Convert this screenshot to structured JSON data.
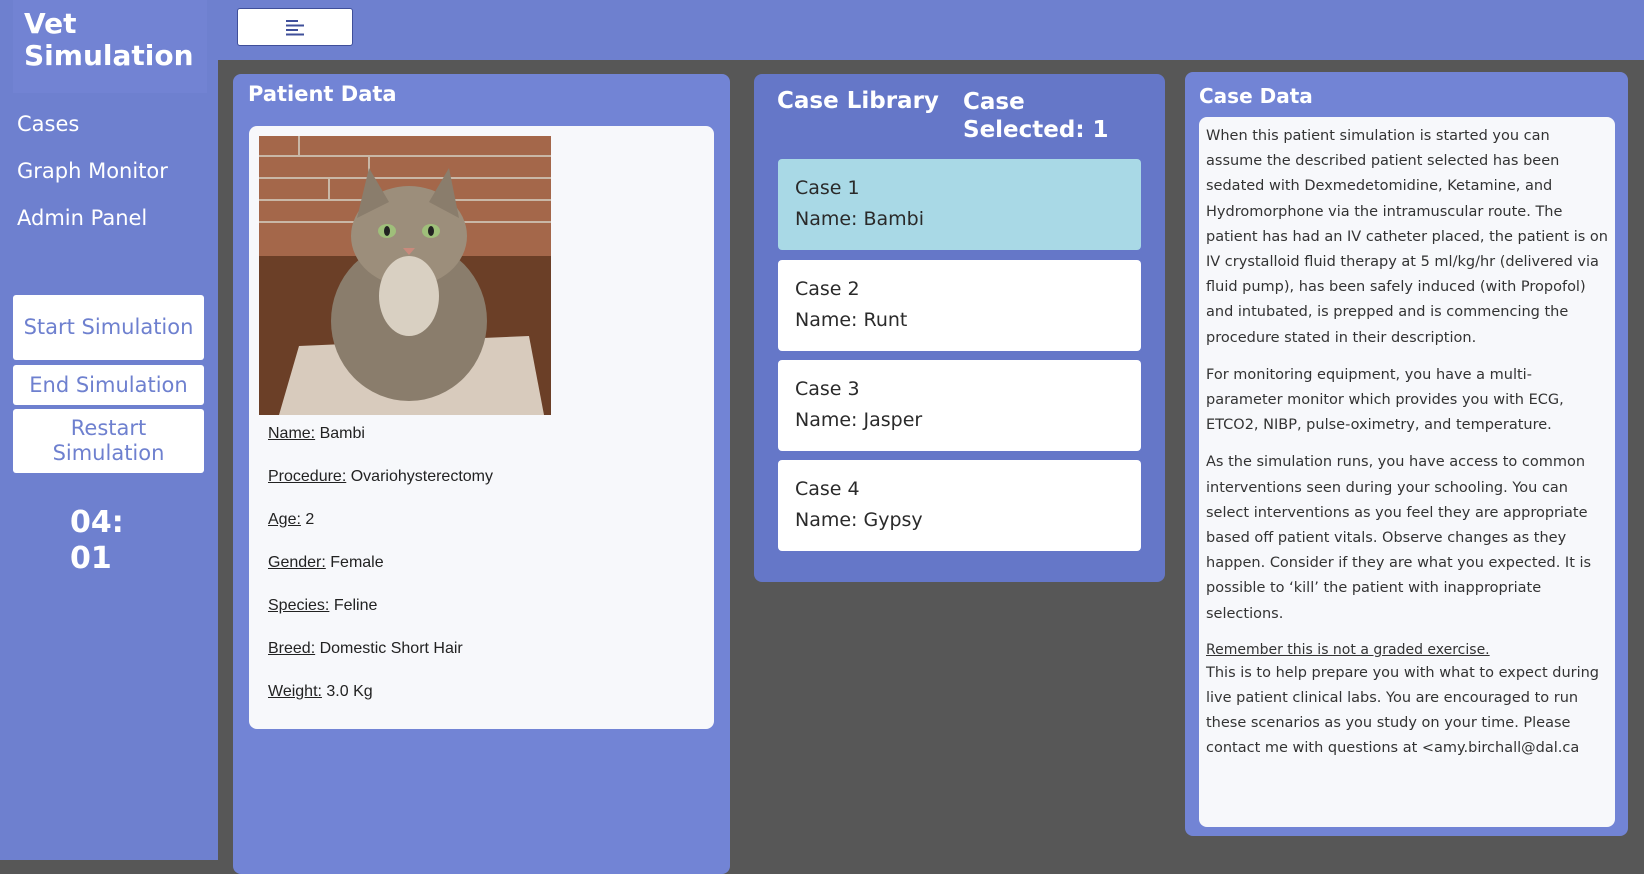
{
  "app": {
    "title": "Vet Simulation"
  },
  "sidebar": {
    "nav": [
      "Cases",
      "Graph Monitor",
      "Admin Panel"
    ],
    "buttons": {
      "start": "Start Simulation",
      "end": "End Simulation",
      "restart": "Restart Simulation"
    },
    "timer": "04:01"
  },
  "topbar": {
    "menu_icon": "menu-icon"
  },
  "patient": {
    "title": "Patient Data",
    "photo_icon": "cat-photo",
    "fields": [
      {
        "label": "Name:",
        "value": "Bambi"
      },
      {
        "label": "Procedure:",
        "value": "Ovariohysterectomy"
      },
      {
        "label": "Age:",
        "value": "2"
      },
      {
        "label": "Gender:",
        "value": "Female"
      },
      {
        "label": "Species:",
        "value": "Feline"
      },
      {
        "label": "Breed:",
        "value": "Domestic Short Hair"
      },
      {
        "label": "Weight:",
        "value": "3.0 Kg"
      }
    ]
  },
  "library": {
    "title": "Case Library",
    "selected_label": "Case Selected: 1",
    "cases": [
      {
        "case": "Case 1",
        "name": "Name: Bambi"
      },
      {
        "case": "Case 2",
        "name": "Name: Runt"
      },
      {
        "case": "Case 3",
        "name": "Name: Jasper"
      },
      {
        "case": "Case 4",
        "name": "Name: Gypsy"
      }
    ]
  },
  "case_data": {
    "title": "Case Data",
    "para1": "When this patient simulation is started you can assume the described patient selected has been sedated with Dexmedetomidine, Ketamine, and Hydromorphone via the intramuscular route. The patient has had an IV catheter placed, the patient is on IV crystalloid fluid therapy at 5 ml/kg/hr (delivered via fluid pump), has been safely induced (with Propofol) and intubated, is prepped and is commencing the procedure stated in their description.",
    "para2": "For monitoring equipment, you have a multi-parameter monitor which provides you with ECG, ETCO2, NIBP, pulse-oximetry, and temperature.",
    "para3": "As the simulation runs, you have access to common interventions seen during your schooling. You can select interventions as you feel they are appropriate based off patient vitals. Observe changes as they happen. Consider if they are what you expected. It is possible to ‘kill’ the patient with inappropriate selections.",
    "note": "Remember this is not a graded exercise.",
    "para4": "This is to help prepare you with what to expect during live patient clinical labs. You are encouraged to run these scenarios as you study on your time. Please contact me with questions at <amy.birchall@dal.ca"
  }
}
